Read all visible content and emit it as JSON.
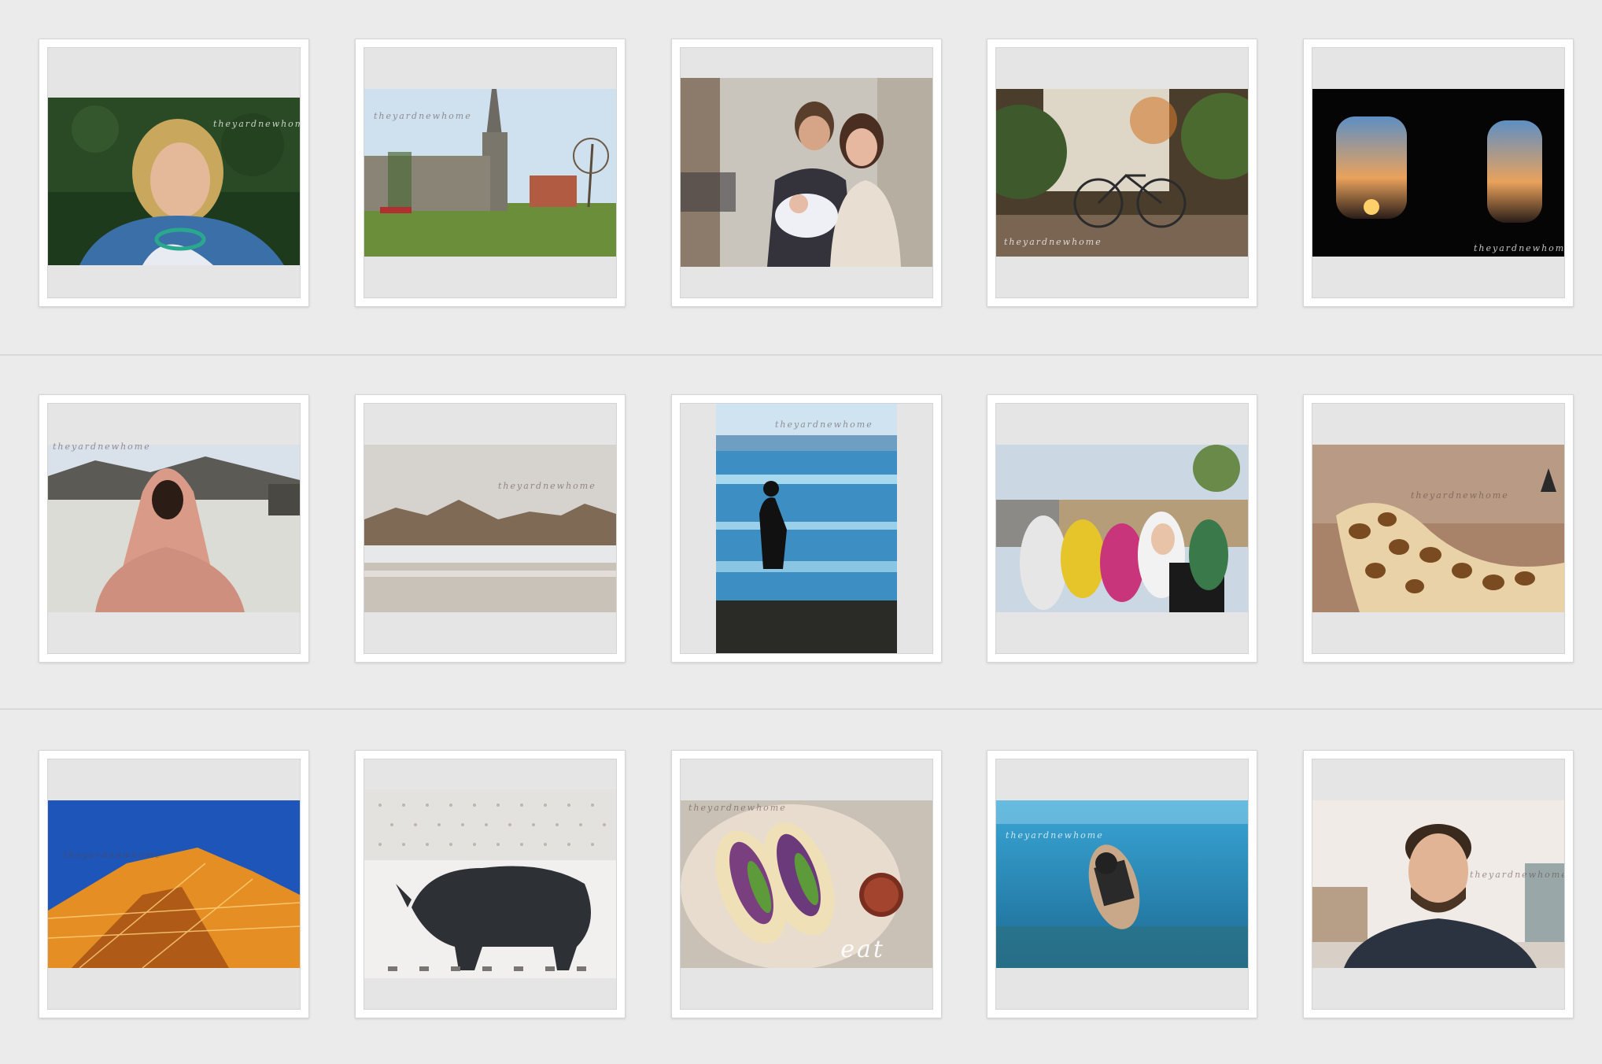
{
  "gallery": {
    "rows": [
      {
        "tiles": [
          {
            "name": "portrait-blonde-woman",
            "watermark": "theyardnewhome"
          },
          {
            "name": "cathedral-park",
            "watermark": "theyardnewhome"
          },
          {
            "name": "hospital-newborn-family",
            "watermark": ""
          },
          {
            "name": "bicycle-garden",
            "watermark": "theyardnewhome"
          },
          {
            "name": "airplane-windows-sunset",
            "watermark": "theyardnewhome"
          }
        ]
      },
      {
        "tiles": [
          {
            "name": "girl-pink-headscarf",
            "watermark": "theyardnewhome"
          },
          {
            "name": "beach-hills",
            "watermark": "theyardnewhome"
          },
          {
            "name": "silhouette-shore",
            "watermark": "theyardnewhome"
          },
          {
            "name": "group-selfie",
            "watermark": ""
          },
          {
            "name": "giraffe-neck",
            "watermark": "theyardnewhome"
          }
        ]
      },
      {
        "tiles": [
          {
            "name": "eiffel-tower-lights",
            "watermark": "theyardnewhome"
          },
          {
            "name": "rhino-figurine",
            "watermark": ""
          },
          {
            "name": "tacos-plate",
            "watermark": "theyardnewhome",
            "caption": "eat"
          },
          {
            "name": "snorkeler-underwater",
            "watermark": "theyardnewhome"
          },
          {
            "name": "smiling-man",
            "watermark": "theyardnewhome"
          }
        ]
      }
    ]
  }
}
